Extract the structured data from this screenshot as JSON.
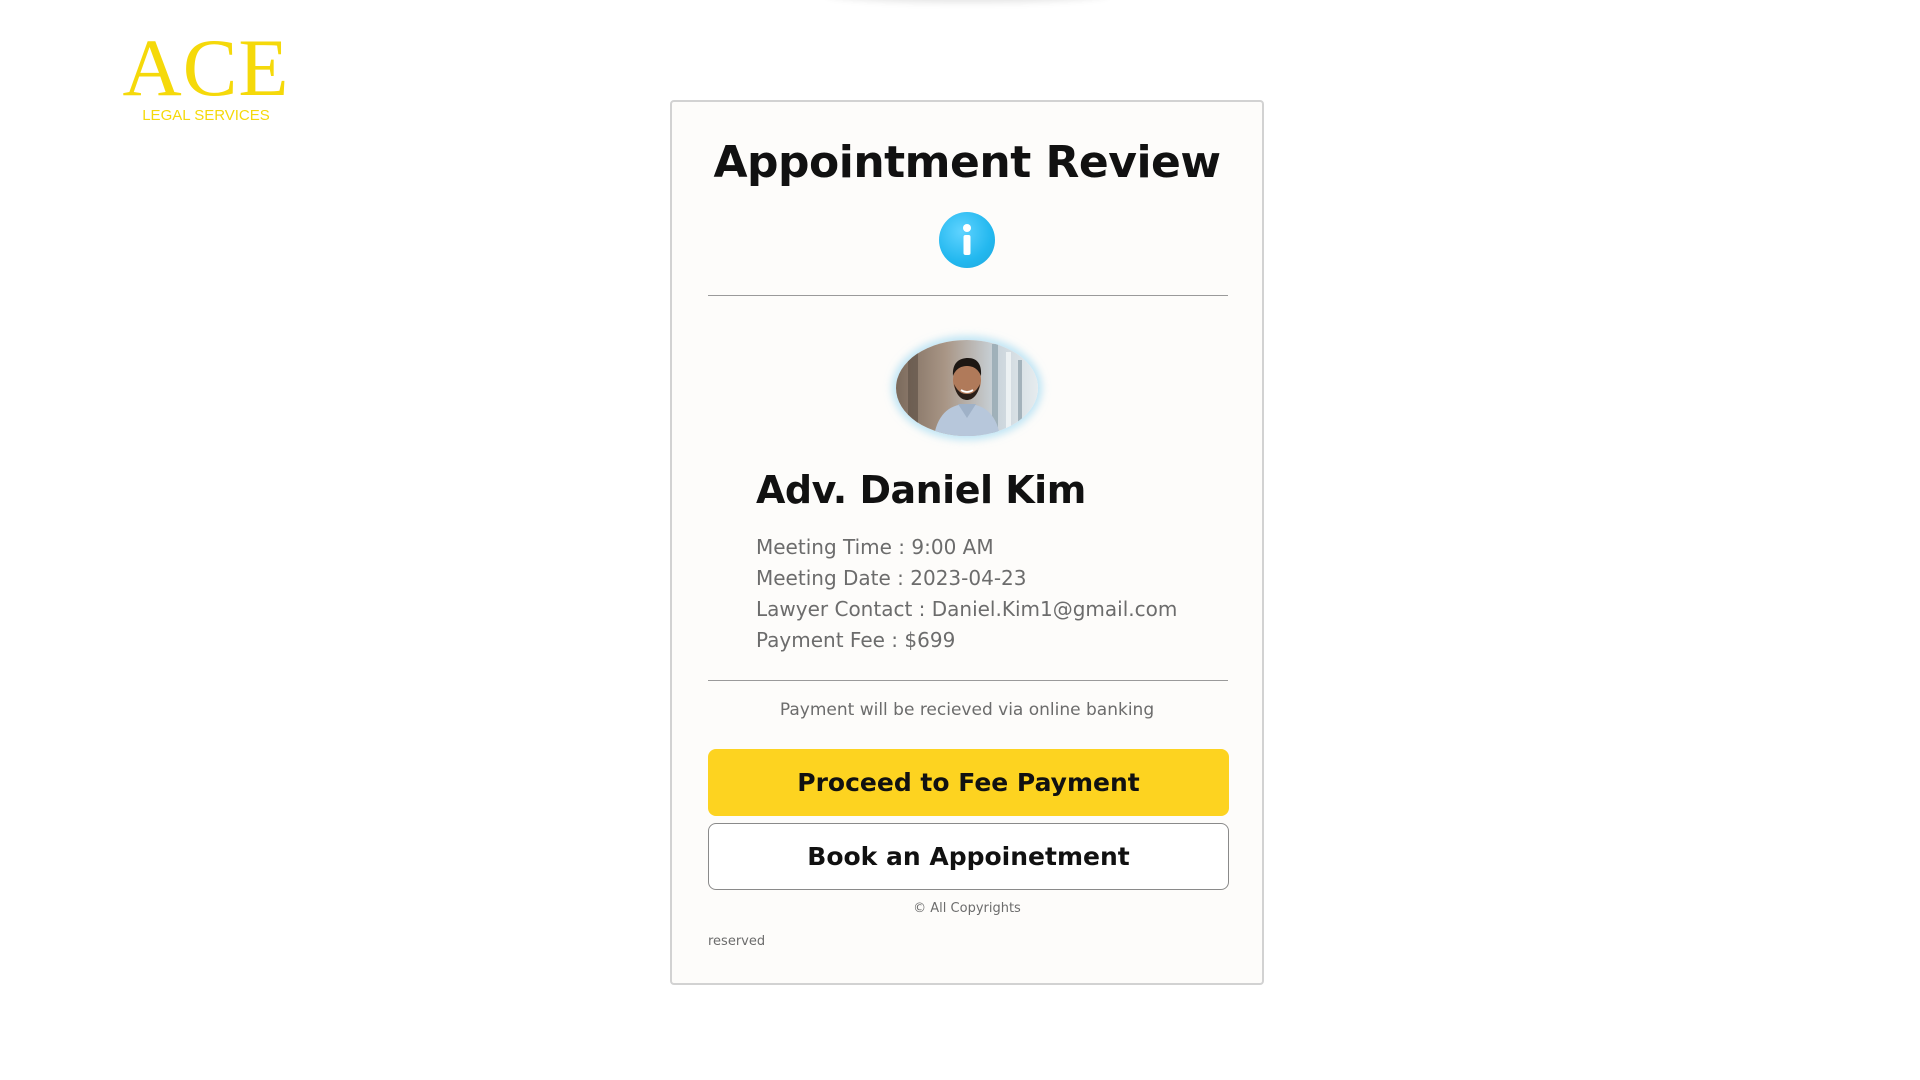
{
  "logo": {
    "main": "ACE",
    "sub": "LEGAL SERVICES"
  },
  "card": {
    "title": "Appointment Review",
    "info_icon": "info-circle-icon",
    "lawyer_name": "Adv. Daniel Kim",
    "details": [
      "Meeting Time : 9:00 AM",
      "Meeting Date : 2023-04-23",
      "Lawyer Contact : Daniel.Kim1@gmail.com",
      "Payment Fee : $699"
    ],
    "payment_note": "Payment will be recieved via online banking",
    "primary_button": "Proceed to Fee Payment",
    "secondary_button": "Book an Appoinetment",
    "copyright": "© All Copyrights",
    "reserved": "reserved"
  },
  "colors": {
    "brand_yellow": "#f5d90a",
    "button_yellow": "#fdd320",
    "info_blue": "#23b8ef",
    "text_dark": "#111111",
    "text_muted": "#6c6c6c"
  }
}
